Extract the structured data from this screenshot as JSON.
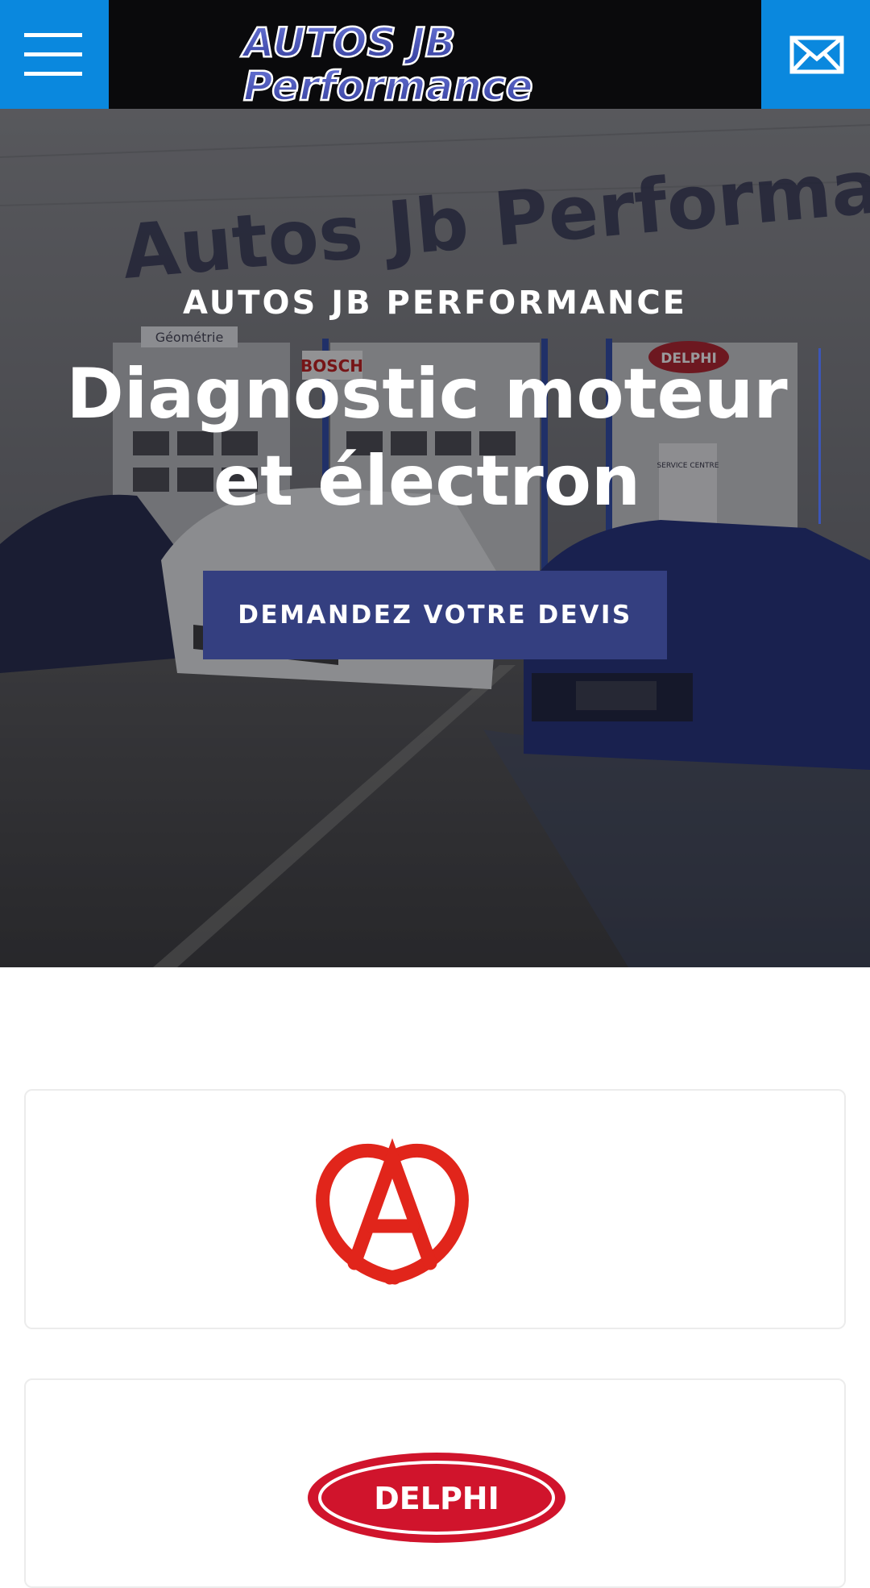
{
  "header": {
    "menu_icon": "hamburger-menu-icon",
    "mail_icon": "envelope-icon",
    "logo": {
      "line1": "AUTOS JB",
      "line2": "Performance"
    }
  },
  "hero": {
    "kicker": "AUTOS JB PERFORMANCE",
    "title": "Diagnostic moteur et électron",
    "cta_label": "DEMANDEZ VOTRE DEVIS",
    "background": {
      "sign_text": "Autos Jb Performa",
      "geometrie_label": "Géométrie",
      "bosch_label": "BOSCH",
      "delphi_label": "DELPHI",
      "service_label": "SERVICE CENTRE"
    }
  },
  "partners": [
    {
      "name": "origine-auvergne-logo",
      "brand": ""
    },
    {
      "name": "delphi-logo",
      "brand": "DELPHI"
    }
  ],
  "colors": {
    "accent_blue": "#0a88de",
    "cta_navy": "#343f80",
    "logo_blue": "#4a55b8",
    "auvergne_red": "#e1251b",
    "delphi_red": "#d0142c"
  }
}
